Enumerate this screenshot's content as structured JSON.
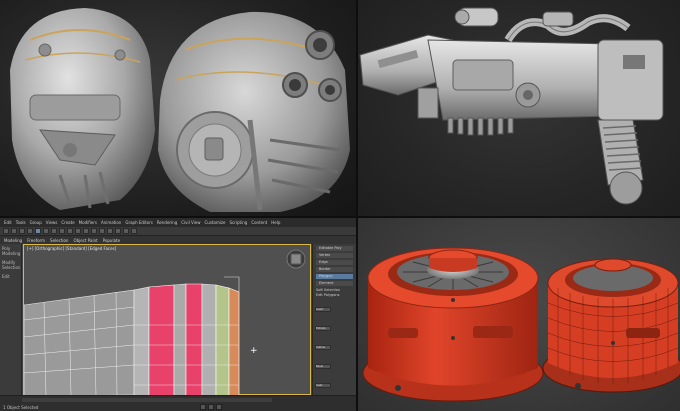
{
  "max_ui": {
    "menu": [
      "Edit",
      "Tools",
      "Group",
      "Views",
      "Create",
      "Modifiers",
      "Animation",
      "Graph Editors",
      "Rendering",
      "Civil View",
      "Customize",
      "Scripting",
      "Content",
      "Help"
    ],
    "ribbon": [
      "Modeling",
      "Freeform",
      "Selection",
      "Object Paint",
      "Populate"
    ],
    "viewport_label": "[+] [Orthographic] [Standard] [Edged Faces]",
    "command_panel": {
      "rows": [
        "Editable Poly",
        "Vertex",
        "Edge",
        "Border",
        "Polygon",
        "Element"
      ],
      "section_soft": "Soft Selection",
      "section_edit": "Edit Polygons",
      "buttons": [
        "Insert Vertex",
        "Extrude",
        "Outline",
        "Bevel",
        "Inset",
        "Bridge",
        "Flip"
      ]
    },
    "status": "1 Object Selected",
    "left_strip": [
      "Poly Modeling",
      "Modify Selection",
      "Edit"
    ]
  },
  "colors": {
    "render_clay": "#b8b8b8",
    "render_orange": "#d93a1e",
    "wire_pink": "#e8426a",
    "wire_green": "#b5c48a",
    "viewport_border": "#d9b84a",
    "selected_blue": "#5b7aa0"
  }
}
